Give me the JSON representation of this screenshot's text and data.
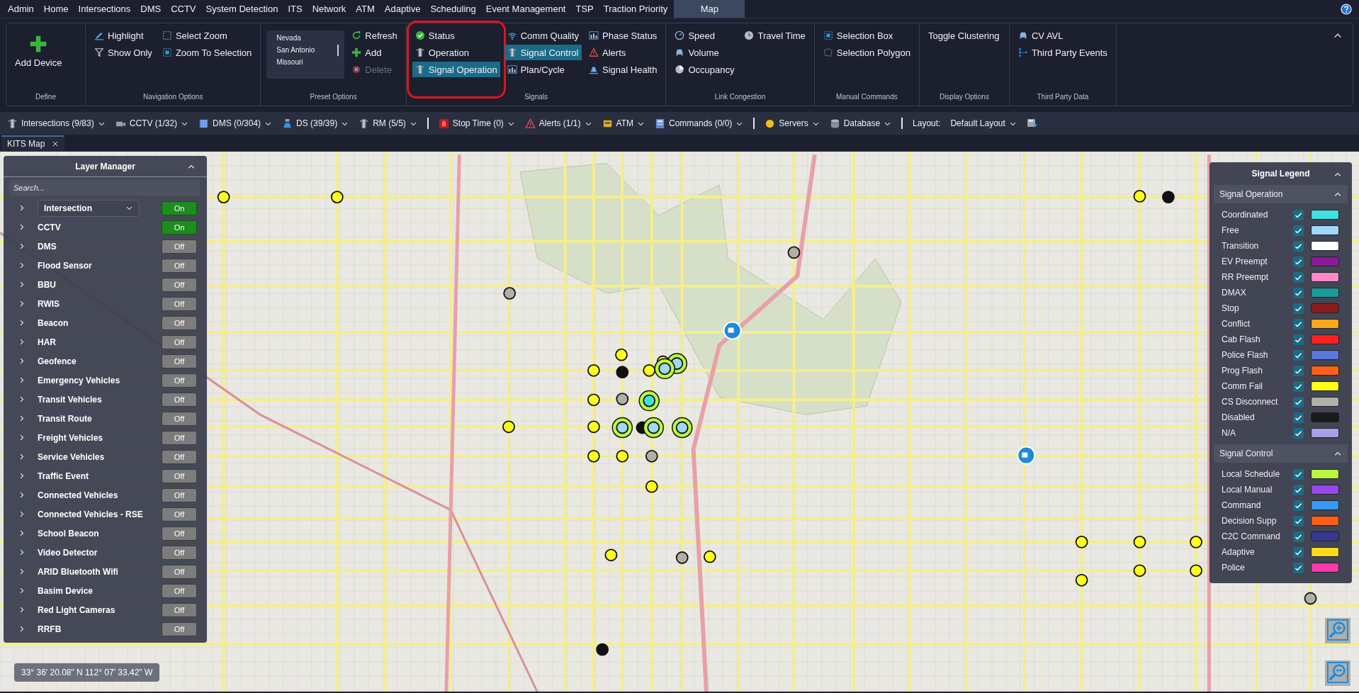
{
  "menu": [
    {
      "label": "Admin",
      "selected": false
    },
    {
      "label": "Home",
      "selected": false
    },
    {
      "label": "Intersections",
      "selected": false
    },
    {
      "label": "DMS",
      "selected": false
    },
    {
      "label": "CCTV",
      "selected": false
    },
    {
      "label": "System Detection",
      "selected": false
    },
    {
      "label": "ITS",
      "selected": false
    },
    {
      "label": "Network",
      "selected": false
    },
    {
      "label": "ATM",
      "selected": false
    },
    {
      "label": "Adaptive",
      "selected": false
    },
    {
      "label": "Scheduling",
      "selected": false
    },
    {
      "label": "Event Management",
      "selected": false
    },
    {
      "label": "TSP",
      "selected": false
    },
    {
      "label": "Traction Priority",
      "selected": false
    },
    {
      "label": "Map",
      "selected": true
    }
  ],
  "ribbon": [
    {
      "label": "Define",
      "columns": [
        [
          {
            "kind": "big",
            "label": "Add Device"
          }
        ]
      ]
    },
    {
      "label": "Navigation Options",
      "columns": [
        [
          {
            "kind": "button",
            "label": "Highlight"
          },
          {
            "kind": "button",
            "label": "Show Only"
          }
        ],
        [
          {
            "kind": "button",
            "label": "Select Zoom"
          },
          {
            "kind": "button",
            "label": "Zoom To Selection"
          }
        ]
      ]
    },
    {
      "label": "Preset Options",
      "columns": [
        [
          {
            "kind": "list",
            "entries": [
              "Nevada",
              "San Antonio",
              "Missouri"
            ]
          }
        ],
        [
          {
            "kind": "button",
            "label": "Refresh",
            "disabled": false
          },
          {
            "kind": "button",
            "label": "Add",
            "disabled": false
          },
          {
            "kind": "button",
            "label": "Delete",
            "disabled": true
          }
        ]
      ]
    },
    {
      "label": "Signals",
      "columns": [
        [
          {
            "kind": "button",
            "label": "Status",
            "selected": false
          },
          {
            "kind": "button",
            "label": "Operation",
            "selected": false
          },
          {
            "kind": "button",
            "label": "Signal Operation",
            "selected": true
          }
        ],
        [
          {
            "kind": "button",
            "label": "Comm Quality",
            "selected": false
          },
          {
            "kind": "button",
            "label": "Signal Control",
            "selected": true
          },
          {
            "kind": "button",
            "label": "Plan/Cycle",
            "selected": false
          }
        ],
        [
          {
            "kind": "button",
            "label": "Phase Status",
            "selected": false
          },
          {
            "kind": "button",
            "label": "Alerts",
            "selected": false
          },
          {
            "kind": "button",
            "label": "Signal Health",
            "selected": false
          }
        ]
      ]
    },
    {
      "label": "Link Congestion",
      "columns": [
        [
          {
            "kind": "button",
            "label": "Speed"
          },
          {
            "kind": "button",
            "label": "Volume"
          },
          {
            "kind": "button",
            "label": "Occupancy"
          }
        ],
        [
          {
            "kind": "button",
            "label": "Travel Time"
          }
        ]
      ]
    },
    {
      "label": "Manual Commands",
      "columns": [
        [
          {
            "kind": "button",
            "label": "Selection Box"
          },
          {
            "kind": "button",
            "label": "Selection Polygon"
          }
        ]
      ]
    },
    {
      "label": "Display Options",
      "columns": [
        [
          {
            "kind": "button",
            "label": "Toggle Clustering"
          }
        ]
      ]
    },
    {
      "label": "Third Party Data",
      "columns": [
        [
          {
            "kind": "button",
            "label": "CV AVL"
          },
          {
            "kind": "button",
            "label": "Third Party Events"
          }
        ]
      ]
    }
  ],
  "toolbar": [
    {
      "kind": "dropdown",
      "label": "Intersections (9/83)"
    },
    {
      "kind": "dropdown",
      "label": "CCTV (1/32)"
    },
    {
      "kind": "dropdown",
      "label": "DMS (0/304)"
    },
    {
      "kind": "dropdown",
      "label": "DS (39/39)"
    },
    {
      "kind": "dropdown",
      "label": "RM (5/5)"
    },
    {
      "kind": "separator"
    },
    {
      "kind": "dropdown",
      "label": "Stop Time (0)"
    },
    {
      "kind": "dropdown",
      "label": "Alerts (1/1)"
    },
    {
      "kind": "dropdown",
      "label": "ATM"
    },
    {
      "kind": "dropdown",
      "label": "Commands (0/0)"
    },
    {
      "kind": "separator"
    },
    {
      "kind": "dropdown",
      "label": "Servers"
    },
    {
      "kind": "dropdown",
      "label": "Database"
    },
    {
      "kind": "separator"
    },
    {
      "kind": "layout",
      "label": "Layout:",
      "value": "Default Layout"
    },
    {
      "kind": "save"
    }
  ],
  "tabs": [
    {
      "label": "KITS Map",
      "selected": true
    }
  ],
  "layer_manager": {
    "title": "Layer Manager",
    "expanded": true,
    "search": {
      "placeholder": "Search..."
    },
    "layers": [
      {
        "kind": "dropdown",
        "label": "Intersection",
        "expanded": false,
        "on": true,
        "toggle": "On"
      },
      {
        "kind": "plain",
        "label": "CCTV",
        "expanded": false,
        "on": true,
        "toggle": "On"
      },
      {
        "kind": "plain",
        "label": "DMS",
        "expanded": false,
        "on": false,
        "toggle": "Off"
      },
      {
        "kind": "plain",
        "label": "Flood Sensor",
        "expanded": false,
        "on": false,
        "toggle": "Off"
      },
      {
        "kind": "plain",
        "label": "BBU",
        "expanded": false,
        "on": false,
        "toggle": "Off"
      },
      {
        "kind": "plain",
        "label": "RWIS",
        "expanded": false,
        "on": false,
        "toggle": "Off"
      },
      {
        "kind": "plain",
        "label": "Beacon",
        "expanded": false,
        "on": false,
        "toggle": "Off"
      },
      {
        "kind": "plain",
        "label": "HAR",
        "expanded": false,
        "on": false,
        "toggle": "Off"
      },
      {
        "kind": "plain",
        "label": "Geofence",
        "expanded": false,
        "on": false,
        "toggle": "Off"
      },
      {
        "kind": "plain",
        "label": "Emergency Vehicles",
        "expanded": false,
        "on": false,
        "toggle": "Off"
      },
      {
        "kind": "plain",
        "label": "Transit Vehicles",
        "expanded": false,
        "on": false,
        "toggle": "Off"
      },
      {
        "kind": "plain",
        "label": "Transit Route",
        "expanded": false,
        "on": false,
        "toggle": "Off"
      },
      {
        "kind": "plain",
        "label": "Freight Vehicles",
        "expanded": false,
        "on": false,
        "toggle": "Off"
      },
      {
        "kind": "plain",
        "label": "Service Vehicles",
        "expanded": false,
        "on": false,
        "toggle": "Off"
      },
      {
        "kind": "plain",
        "label": "Traffic Event",
        "expanded": false,
        "on": false,
        "toggle": "Off"
      },
      {
        "kind": "plain",
        "label": "Connected Vehicles",
        "expanded": false,
        "on": false,
        "toggle": "Off"
      },
      {
        "kind": "plain",
        "label": "Connected Vehicles - RSE",
        "expanded": false,
        "on": false,
        "toggle": "Off"
      },
      {
        "kind": "plain",
        "label": "School Beacon",
        "expanded": false,
        "on": false,
        "toggle": "Off"
      },
      {
        "kind": "plain",
        "label": "Video Detector",
        "expanded": false,
        "on": false,
        "toggle": "Off"
      },
      {
        "kind": "plain",
        "label": "ARID Bluetooth Wifi",
        "expanded": false,
        "on": false,
        "toggle": "Off"
      },
      {
        "kind": "plain",
        "label": "Basim Device",
        "expanded": false,
        "on": false,
        "toggle": "Off"
      },
      {
        "kind": "plain",
        "label": "Red Light Cameras",
        "expanded": false,
        "on": false,
        "toggle": "Off"
      },
      {
        "kind": "plain",
        "label": "RRFB",
        "expanded": false,
        "on": false,
        "toggle": "Off"
      }
    ]
  },
  "legend": {
    "title": "Signal Legend",
    "expanded": true,
    "sections": [
      {
        "title": "Signal Operation",
        "expanded": true,
        "items": [
          {
            "label": "Coordinated",
            "checked": true,
            "color": "#40e0e0"
          },
          {
            "label": "Free",
            "checked": true,
            "color": "#a0d8f8"
          },
          {
            "label": "Transition",
            "checked": true,
            "color": "#ffffff"
          },
          {
            "label": "EV Preempt",
            "checked": true,
            "color": "#8b1a9a"
          },
          {
            "label": "RR Preempt",
            "checked": true,
            "color": "#ff88c8"
          },
          {
            "label": "DMAX",
            "checked": true,
            "color": "#1a9a9a"
          },
          {
            "label": "Stop",
            "checked": true,
            "color": "#8b1a1a"
          },
          {
            "label": "Conflict",
            "checked": true,
            "color": "#f8a818"
          },
          {
            "label": "Cab Flash",
            "checked": true,
            "color": "#ff2020"
          },
          {
            "label": "Police Flash",
            "checked": true,
            "color": "#5878e0"
          },
          {
            "label": "Prog Flash",
            "checked": true,
            "color": "#ff6018"
          },
          {
            "label": "Comm Fail",
            "checked": true,
            "color": "#ffff18"
          },
          {
            "label": "CS Disconnect",
            "checked": true,
            "color": "#b0b0a8"
          },
          {
            "label": "Disabled",
            "checked": true,
            "color": "#1a1a1a"
          },
          {
            "label": "N/A",
            "checked": true,
            "color": "#a8a0e8"
          }
        ]
      },
      {
        "title": "Signal Control",
        "expanded": true,
        "items": [
          {
            "label": "Local Schedule",
            "checked": true,
            "color": "#b8f840"
          },
          {
            "label": "Local Manual",
            "checked": true,
            "color": "#9848e8"
          },
          {
            "label": "Command",
            "checked": true,
            "color": "#3898f8"
          },
          {
            "label": "Decision Supp",
            "checked": true,
            "color": "#ff6018"
          },
          {
            "label": "C2C Command",
            "checked": true,
            "color": "#383890"
          },
          {
            "label": "Adaptive",
            "checked": true,
            "color": "#ffd818"
          },
          {
            "label": "Police",
            "checked": true,
            "color": "#ff38a8"
          }
        ]
      }
    ]
  },
  "coordinates": "33° 36' 20.08\" N 112° 07' 33.42\" W"
}
